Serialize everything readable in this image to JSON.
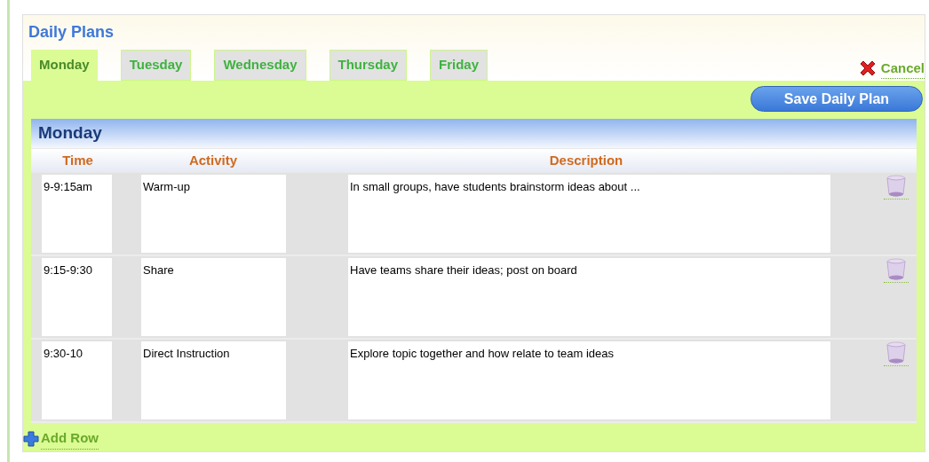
{
  "title": "Daily Plans",
  "tabs": [
    {
      "label": "Monday",
      "selected": true
    },
    {
      "label": "Tuesday",
      "selected": false
    },
    {
      "label": "Wednesday",
      "selected": false
    },
    {
      "label": "Thursday",
      "selected": false
    },
    {
      "label": "Friday",
      "selected": false
    }
  ],
  "cancel": "Cancel",
  "save_button": "Save Daily Plan",
  "day_heading": "Monday",
  "columns": [
    "Time",
    "Activity",
    "Description"
  ],
  "rows": [
    {
      "time": "9-9:15am",
      "activity": "Warm-up",
      "description": "In small groups, have students brainstorm ideas about ..."
    },
    {
      "time": "9:15-9:30",
      "activity": "Share",
      "description": "Have teams share their ideas; post on board"
    },
    {
      "time": "9:30-10",
      "activity": "Direct Instruction",
      "description": "Explore topic together and how relate to team ideas"
    }
  ],
  "add_row": "Add Row"
}
